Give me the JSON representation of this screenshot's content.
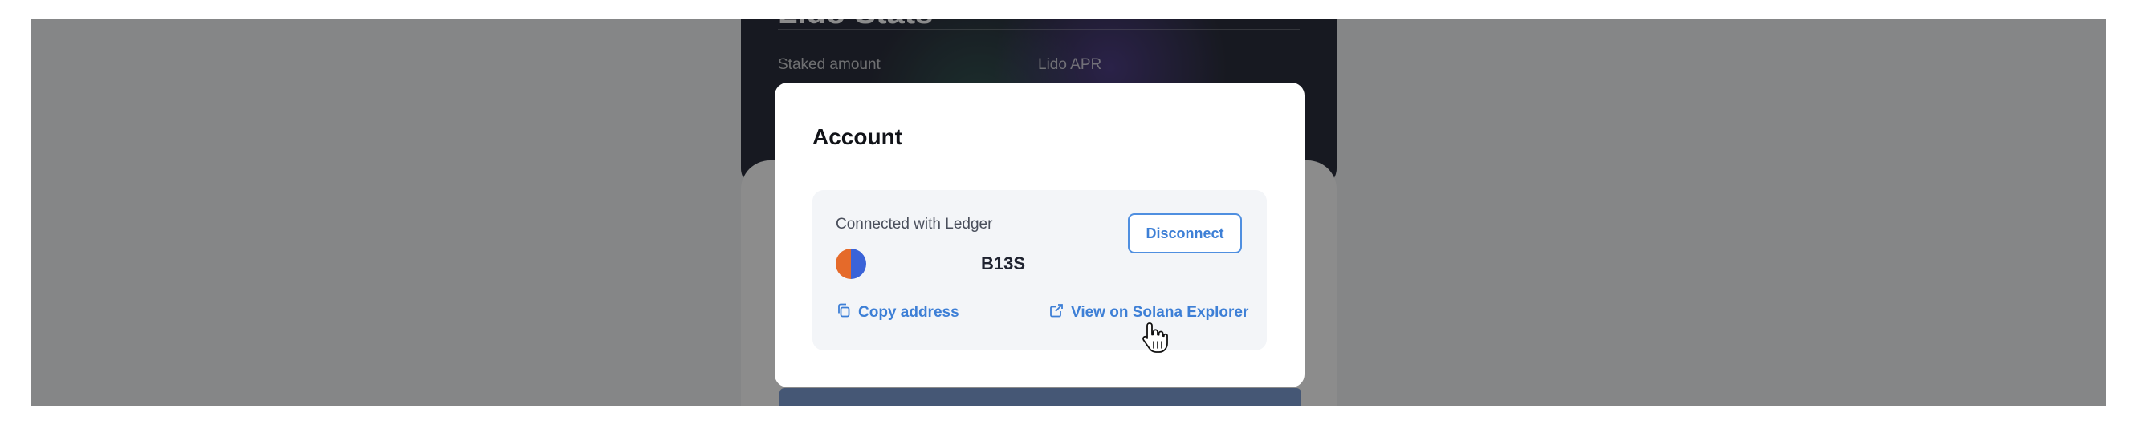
{
  "background": {
    "heading": "Lido Stats",
    "label_left": "Staked amount",
    "label_right": "Lido APR"
  },
  "modal": {
    "title": "Account",
    "connected_text": "Connected with Ledger",
    "address_short": "B13S",
    "disconnect_label": "Disconnect",
    "copy_label": "Copy address",
    "explorer_label": "View on Solana Explorer"
  },
  "colors": {
    "accent": "#3d7fd6",
    "avatar_left": "#e56a2a",
    "avatar_right": "#3a63d8"
  },
  "icons": {
    "copy": "copy-icon",
    "external": "external-link-icon",
    "cursor": "hand-pointer-cursor"
  }
}
